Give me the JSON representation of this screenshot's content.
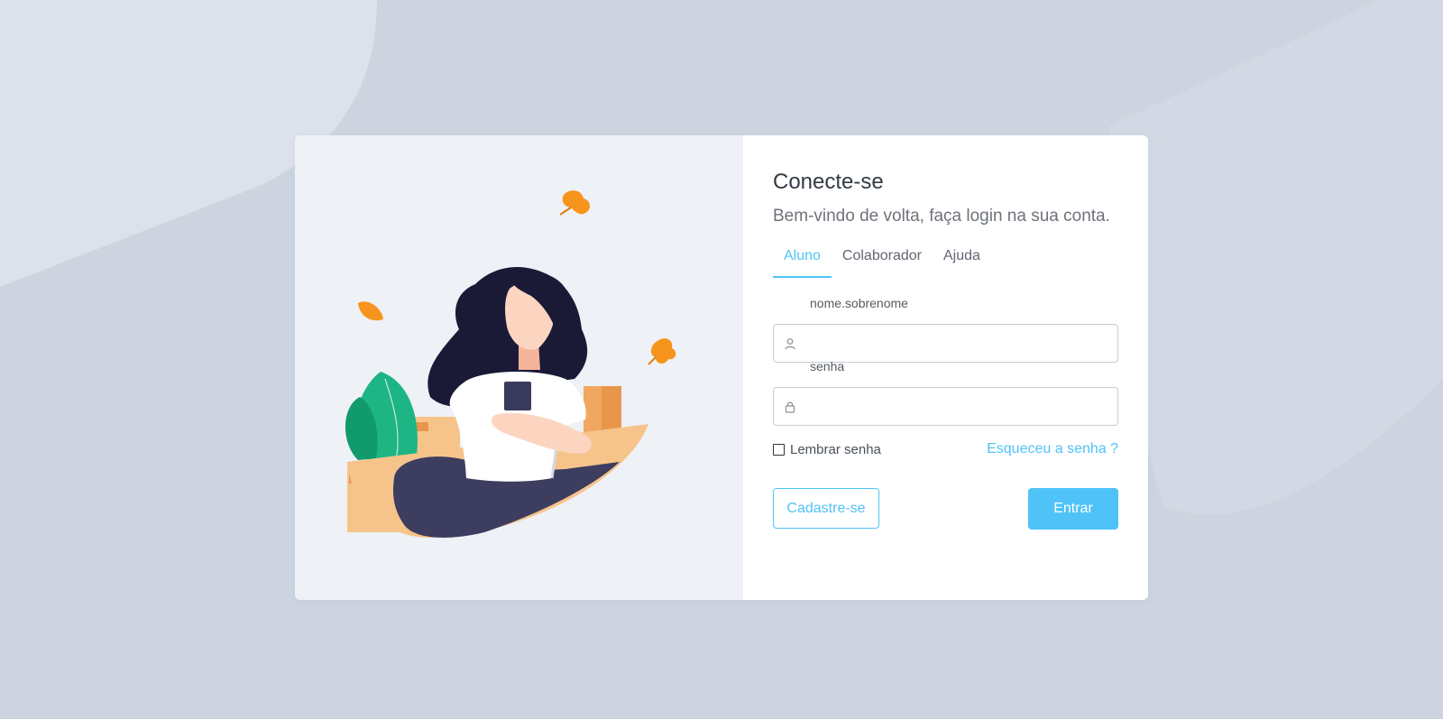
{
  "login": {
    "title": "Conecte-se",
    "subtitle": "Bem-vindo de volta, faça login na sua conta.",
    "tabs": [
      {
        "label": "Aluno",
        "active": true
      },
      {
        "label": "Colaborador",
        "active": false
      },
      {
        "label": "Ajuda",
        "active": false
      }
    ],
    "username": {
      "label": "nome.sobrenome",
      "value": "",
      "icon": "user-icon"
    },
    "password": {
      "label": "senha",
      "value": "",
      "icon": "lock-icon"
    },
    "remember_label": "Lembrar senha",
    "remember_checked": false,
    "forgot_label": "Esqueceu a senha ?",
    "register_label": "Cadastre-se",
    "submit_label": "Entrar"
  },
  "colors": {
    "accent": "#4fc3f7",
    "background": "#cdd4e0",
    "illustration_panel": "#eef1f6"
  }
}
